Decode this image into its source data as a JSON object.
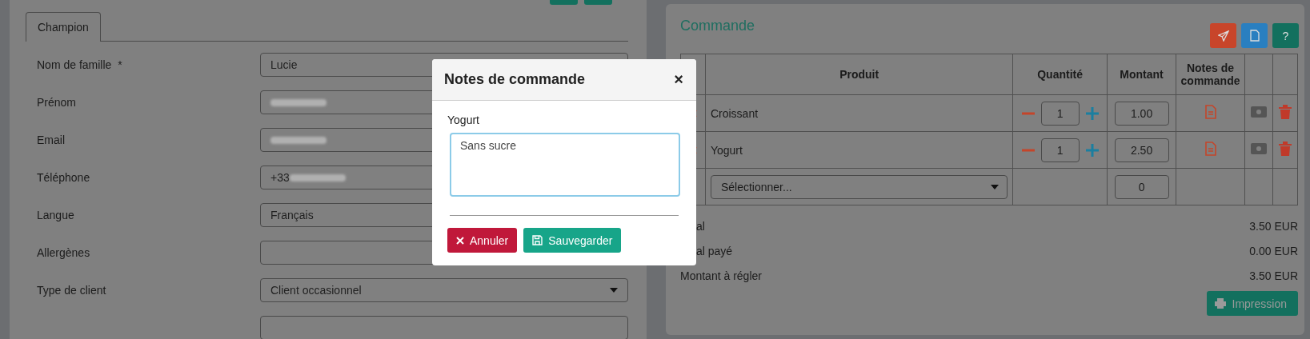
{
  "customer": {
    "tabs": [
      {
        "label": "Champion",
        "selected": true
      }
    ],
    "fields": [
      {
        "label": "Nom de famille",
        "required_mark": "*",
        "kind": "text",
        "value": "Lucie"
      },
      {
        "label": "Prénom",
        "kind": "redacted"
      },
      {
        "label": "Email",
        "kind": "redacted"
      },
      {
        "label": "Téléphone",
        "kind": "redacted",
        "value": "+33"
      },
      {
        "label": "Langue",
        "kind": "text",
        "value": "Français"
      },
      {
        "label": "Allergènes",
        "kind": "text"
      },
      {
        "label": "Type de client",
        "kind": "select",
        "value": "Client occasionnel"
      }
    ]
  },
  "order": {
    "title": "Commande",
    "header_buttons": [
      {
        "kind": "send"
      },
      {
        "kind": "pdf"
      },
      {
        "kind": "help",
        "label": "?"
      }
    ],
    "columns": [
      "Produit",
      "Quantité",
      "Montant",
      "Notes de commande"
    ],
    "rows": [
      {
        "product": "Croissant",
        "quantity": "1",
        "amount": "1.00"
      },
      {
        "product": "Yogurt",
        "quantity": "1",
        "amount": "2.50"
      }
    ],
    "new_row": {
      "placeholder": "Sélectionner...",
      "amount": "0"
    },
    "totals": [
      {
        "label": "al",
        "value": "3.50 EUR"
      },
      {
        "label": "al payé",
        "value": "0.00 EUR"
      },
      {
        "label": "Montant à régler",
        "value": "3.50 EUR"
      }
    ],
    "print_button": "Impression"
  },
  "modal": {
    "title": "Notes de commande",
    "close": "×",
    "item_label": "Yogurt",
    "note": "Sans sucre",
    "cancel": "Annuler",
    "save": "Sauvegarder"
  }
}
